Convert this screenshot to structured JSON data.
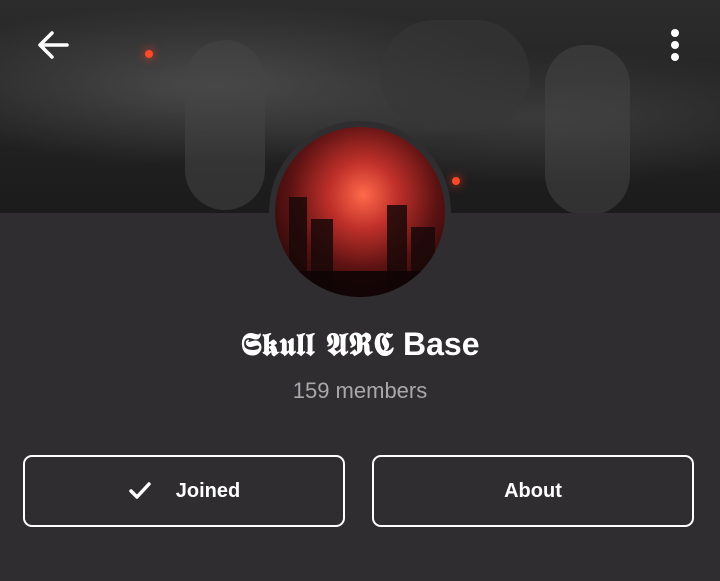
{
  "header": {
    "back_icon": "arrow-left-icon",
    "menu_icon": "more-vertical-icon"
  },
  "group": {
    "title_styled": "𝕾𝖐𝖚𝖑𝖑 𝕬𝕽𝕮",
    "title_plain": " Base",
    "members": "159 members"
  },
  "actions": {
    "joined_label": "Joined",
    "joined_icon": "check-icon",
    "about_label": "About"
  },
  "colors": {
    "background": "#2f2d30",
    "text_primary": "#ffffff",
    "text_secondary": "#a9a7aa"
  }
}
